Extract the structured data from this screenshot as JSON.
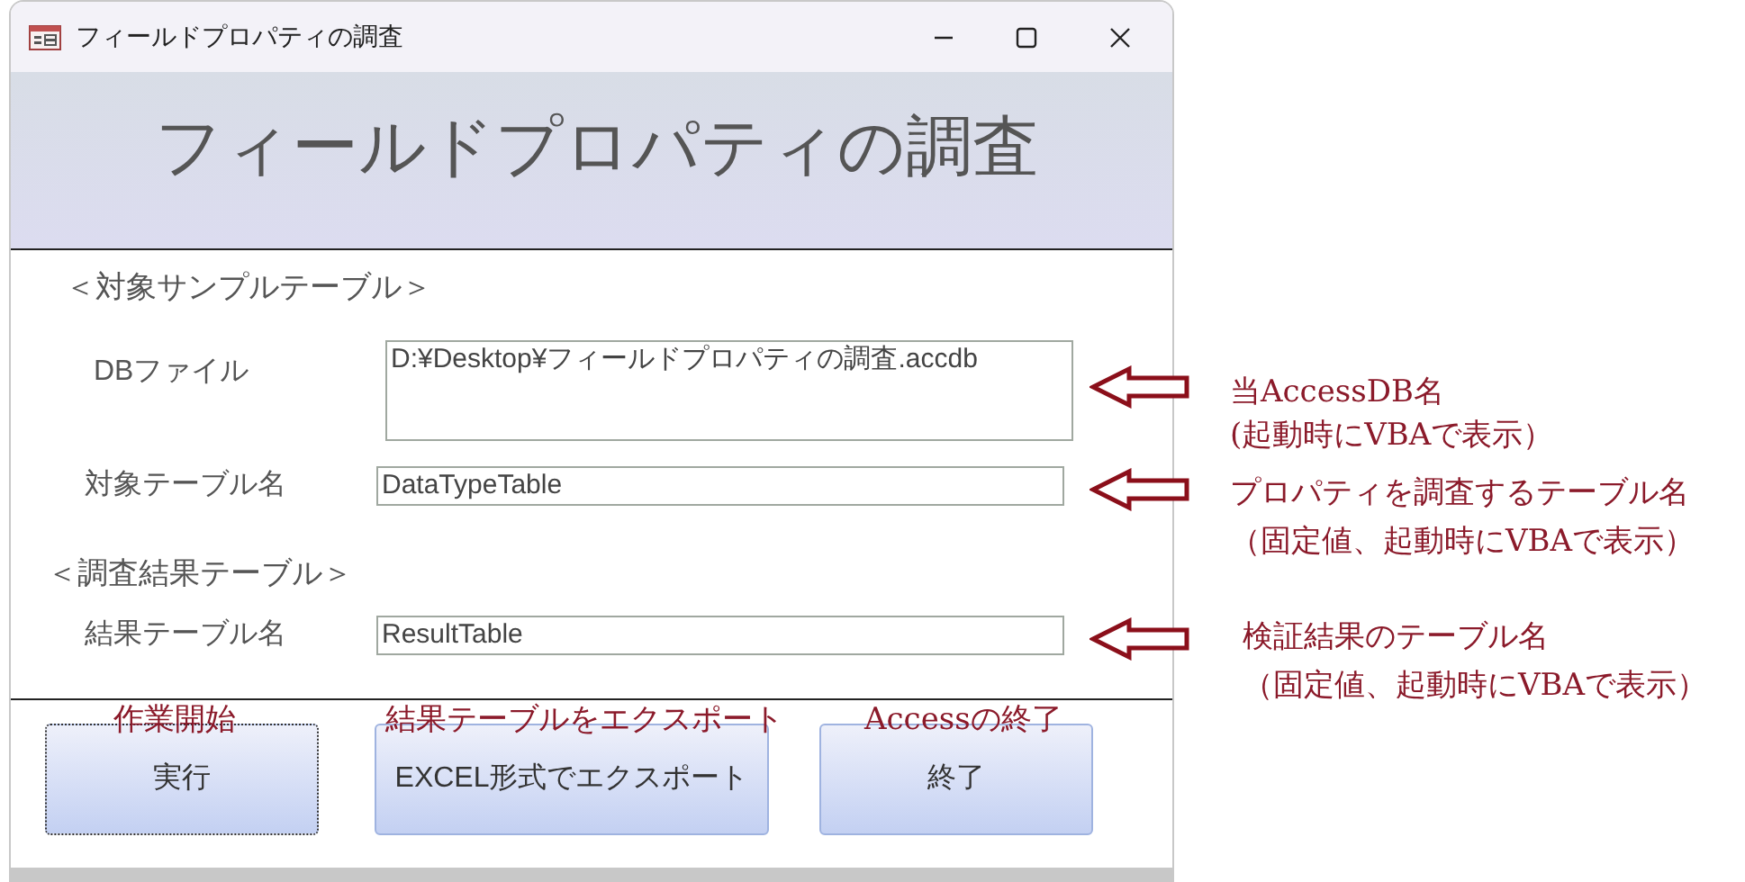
{
  "window": {
    "title": "フィールドプロパティの調査"
  },
  "header": {
    "title": "フィールドプロパティの調査"
  },
  "sections": [
    {
      "heading": "＜対象サンプルテーブル＞",
      "fields": [
        {
          "label": "DBファイル",
          "value": "D:¥Desktop¥フィールドプロパティの調査.accdb",
          "kind": "multiline"
        },
        {
          "label": "対象テーブル名",
          "value": "DataTypeTable",
          "kind": "single"
        }
      ]
    },
    {
      "heading": "＜調査結果テーブル＞",
      "fields": [
        {
          "label": "結果テーブル名",
          "value": "ResultTable",
          "kind": "single"
        }
      ]
    }
  ],
  "buttons": [
    {
      "label": "実行",
      "focused": true
    },
    {
      "label": "EXCEL形式でエクスポート",
      "focused": false
    },
    {
      "label": "終了",
      "focused": false
    }
  ],
  "annotations": {
    "fields": [
      {
        "lines": [
          "当AccessDB名",
          "(起動時にVBAで表示）"
        ]
      },
      {
        "lines": [
          "プロパティを調査するテーブル名",
          "（固定値、起動時にVBAで表示）"
        ]
      },
      {
        "lines": [
          "検証結果のテーブル名",
          "（固定値、起動時にVBAで表示）"
        ]
      }
    ],
    "buttons": [
      "作業開始",
      "結果テーブルをエクスポート",
      "Accessの終了"
    ]
  }
}
